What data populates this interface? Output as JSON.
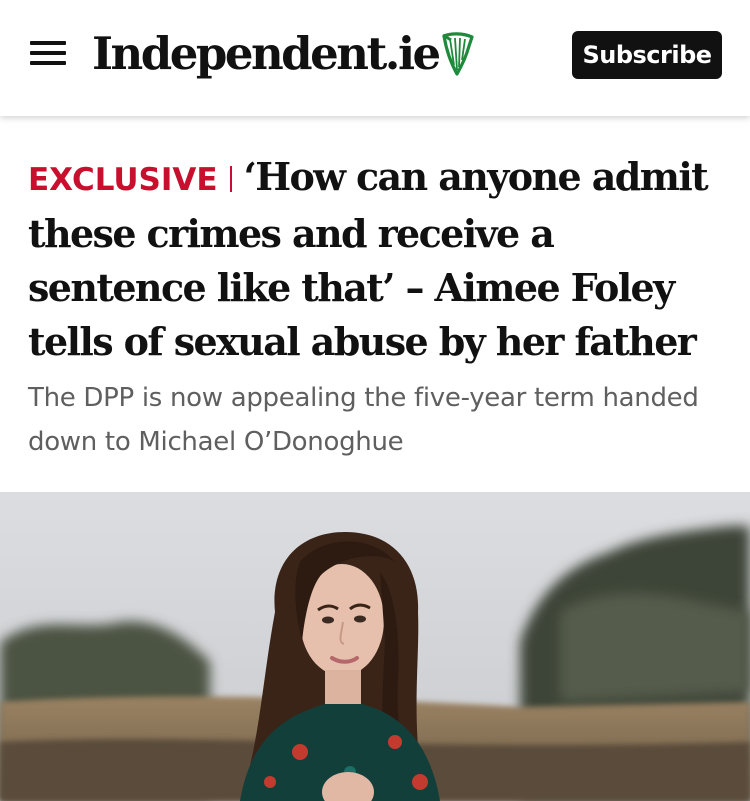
{
  "header": {
    "menu_icon": "hamburger-menu-icon",
    "logo_text": "Independent.ie",
    "logo_icon": "harp-icon",
    "subscribe_label": "Subscribe"
  },
  "article": {
    "kicker": "EXCLUSIVE",
    "headline": "‘How can anyone admit these crimes and receive a sentence like that’ – Aimee Foley tells of sexual abuse by her father",
    "subtitle": "The DPP is now appealing the five-year term handed down to Michael O’Donoghue"
  },
  "colors": {
    "kicker": "#c8102e",
    "subtitle": "#5f5f5f",
    "subscribe_bg": "#111111",
    "harp_green": "#1e8a3c"
  }
}
